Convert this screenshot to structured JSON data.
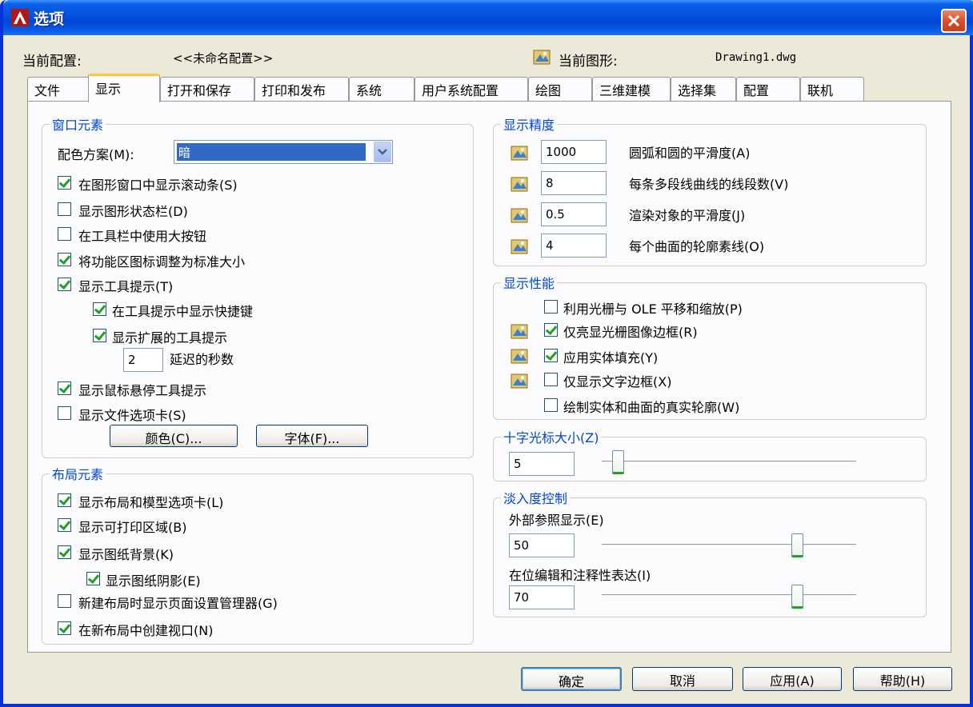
{
  "window": {
    "title": "选项"
  },
  "header": {
    "profile_label": "当前配置:",
    "profile_value": "<<未命名配置>>",
    "drawing_label": "当前图形:",
    "drawing_value": "Drawing1.dwg"
  },
  "tabs": [
    "文件",
    "显示",
    "打开和保存",
    "打印和发布",
    "系统",
    "用户系统配置",
    "绘图",
    "三维建模",
    "选择集",
    "配置",
    "联机"
  ],
  "window_elements": {
    "title": "窗口元素",
    "color_scheme_label": "配色方案(M):",
    "color_scheme_value": "暗",
    "checkboxes": [
      {
        "label": "在图形窗口中显示滚动条(S)",
        "checked": true
      },
      {
        "label": "显示图形状态栏(D)",
        "checked": false
      },
      {
        "label": "在工具栏中使用大按钮",
        "checked": false
      },
      {
        "label": "将功能区图标调整为标准大小",
        "checked": true
      },
      {
        "label": "显示工具提示(T)",
        "checked": true
      },
      {
        "label": "在工具提示中显示快捷键",
        "checked": true
      },
      {
        "label": "显示扩展的工具提示",
        "checked": true
      },
      {
        "label": "显示鼠标悬停工具提示",
        "checked": true
      },
      {
        "label": "显示文件选项卡(S)",
        "checked": false
      }
    ],
    "delay_value": "2",
    "delay_label": "延迟的秒数",
    "colors_button": "颜色(C)...",
    "fonts_button": "字体(F)..."
  },
  "layout_elements": {
    "title": "布局元素",
    "checkboxes": [
      {
        "label": "显示布局和模型选项卡(L)",
        "checked": true
      },
      {
        "label": "显示可打印区域(B)",
        "checked": true
      },
      {
        "label": "显示图纸背景(K)",
        "checked": true
      },
      {
        "label": "显示图纸阴影(E)",
        "checked": true
      },
      {
        "label": "新建布局时显示页面设置管理器(G)",
        "checked": false
      },
      {
        "label": "在新布局中创建视口(N)",
        "checked": true
      }
    ]
  },
  "display_resolution": {
    "title": "显示精度",
    "rows": [
      {
        "value": "1000",
        "label": "圆弧和圆的平滑度(A)"
      },
      {
        "value": "8",
        "label": "每条多段线曲线的线段数(V)"
      },
      {
        "value": "0.5",
        "label": "渲染对象的平滑度(J)"
      },
      {
        "value": "4",
        "label": "每个曲面的轮廓素线(O)"
      }
    ]
  },
  "display_performance": {
    "title": "显示性能",
    "checkboxes": [
      {
        "label": "利用光栅与 OLE 平移和缩放(P)",
        "checked": false
      },
      {
        "label": "仅亮显光栅图像边框(R)",
        "checked": true
      },
      {
        "label": "应用实体填充(Y)",
        "checked": true
      },
      {
        "label": "仅显示文字边框(X)",
        "checked": false
      },
      {
        "label": "绘制实体和曲面的真实轮廓(W)",
        "checked": false
      }
    ]
  },
  "crosshair": {
    "title": "十字光标大小(Z)",
    "value": "5",
    "level": 5
  },
  "fade": {
    "title": "淡入度控制",
    "xref_label": "外部参照显示(E)",
    "xref_value": "50",
    "xref_level": 50,
    "inplace_label": "在位编辑和注释性表达(I)",
    "inplace_value": "70",
    "inplace_level": 70
  },
  "buttons": {
    "ok": "确定",
    "cancel": "取消",
    "apply": "应用(A)",
    "help": "帮助(H)"
  },
  "colors": {
    "titlebar": "#0553dd",
    "group_title": "#0046d5",
    "check": "#21a121",
    "selection": "#316ac5"
  }
}
